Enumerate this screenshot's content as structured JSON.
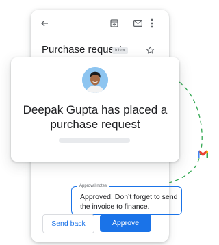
{
  "email": {
    "subject": "Purchase request",
    "label": "Inbox"
  },
  "icons": {
    "back": "arrow-back-icon",
    "archive": "archive-icon",
    "mail": "mail-icon",
    "more": "more-vert-icon",
    "star": "star-outline-icon",
    "logo": "gmail-logo"
  },
  "card": {
    "message": "Deepak Gupta has placed a purchase request"
  },
  "approval": {
    "notes_label": "Approval notes",
    "notes_value": "Approved! Don’t forget to send the invoice to finance.",
    "send_back_label": "Send back",
    "approve_label": "Approve"
  },
  "colors": {
    "accent": "#1a73e8",
    "connector": "#34a853",
    "gmail_red": "#ea4335"
  }
}
